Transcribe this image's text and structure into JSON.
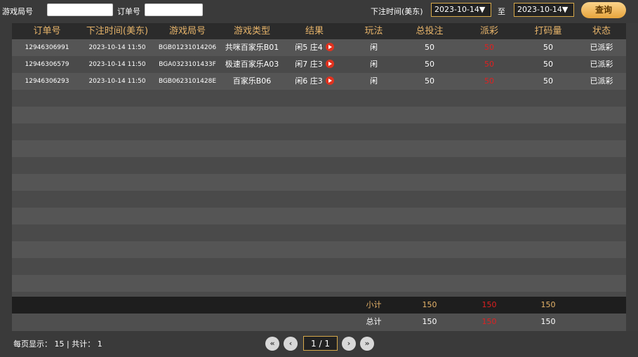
{
  "filters": {
    "game_no_label": "游戏局号",
    "order_no_label": "订单号",
    "bet_time_label": "下注时间(美东)",
    "date_from": "2023-10-14▼",
    "date_sep": "至",
    "date_to": "2023-10-14▼",
    "query_label": "查询"
  },
  "table": {
    "headers": [
      "订单号",
      "下注时间(美东)",
      "游戏局号",
      "游戏类型",
      "结果",
      "玩法",
      "总投注",
      "派彩",
      "打码量",
      "状态"
    ],
    "rows": [
      {
        "order": "12946306991",
        "time": "2023-10-14 11:50",
        "game_no": "BGB01231014206",
        "game_type": "共咪百家乐B01",
        "result": "闲5 庄4",
        "play": "闲",
        "bet": "50",
        "payout": "50",
        "rolling": "50",
        "status": "已派彩"
      },
      {
        "order": "12946306579",
        "time": "2023-10-14 11:50",
        "game_no": "BGA0323101433F",
        "game_type": "极速百家乐A03",
        "result": "闲7 庄3",
        "play": "闲",
        "bet": "50",
        "payout": "50",
        "rolling": "50",
        "status": "已派彩"
      },
      {
        "order": "12946306293",
        "time": "2023-10-14 11:50",
        "game_no": "BGB0623101428E",
        "game_type": "百家乐B06",
        "result": "闲6 庄3",
        "play": "闲",
        "bet": "50",
        "payout": "50",
        "rolling": "50",
        "status": "已派彩"
      }
    ],
    "empty_rows": 12
  },
  "subtotal": {
    "label": "小计",
    "bet": "150",
    "payout": "150",
    "rolling": "150"
  },
  "total": {
    "label": "总计",
    "bet": "150",
    "payout": "150",
    "rolling": "150"
  },
  "footer": {
    "per_page_label": "每页显示：",
    "per_page": "15",
    "sep": "|",
    "total_label": "共计：",
    "total": "1"
  },
  "pager": {
    "page_display": "1 / 1"
  },
  "colors": {
    "accent": "#e7b46a",
    "payout": "#e02020",
    "header_bg": "#2b2b2b"
  }
}
